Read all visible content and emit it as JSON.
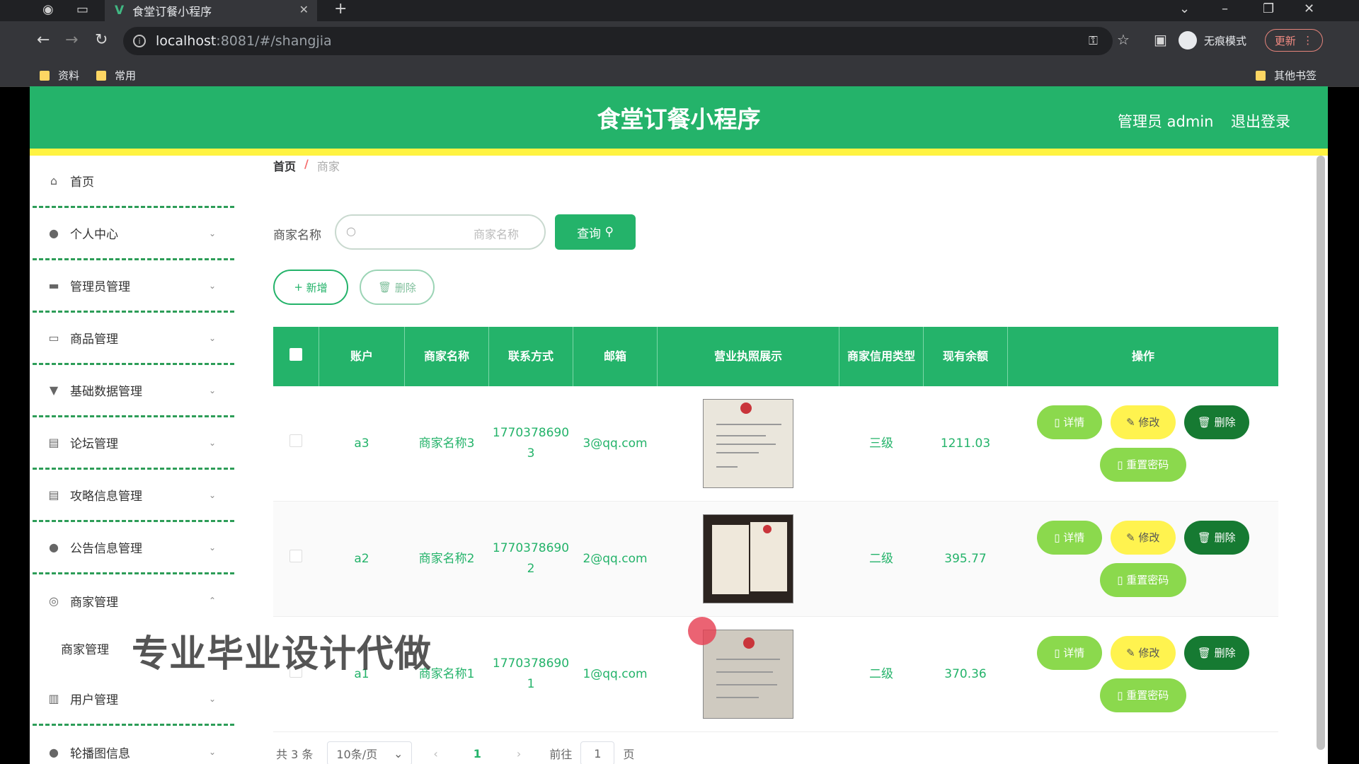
{
  "browser": {
    "tab_title": "食堂订餐小程序",
    "tab_close": "✕",
    "new_tab": "+",
    "url_host": "localhost",
    "url_path": ":8081/#/shangjia",
    "incognito_label": "无痕模式",
    "update_label": "更新",
    "bookmarks": [
      "资料",
      "常用"
    ],
    "other_bookmarks": "其他书签"
  },
  "header": {
    "title": "食堂订餐小程序",
    "admin_label": "管理员 admin",
    "logout_label": "退出登录"
  },
  "sidebar": {
    "items": [
      {
        "label": "首页",
        "icon": "home-icon"
      },
      {
        "label": "个人中心",
        "icon": "user-icon"
      },
      {
        "label": "管理员管理",
        "icon": "briefcase-icon"
      },
      {
        "label": "商品管理",
        "icon": "chat-icon"
      },
      {
        "label": "基础数据管理",
        "icon": "pin-icon"
      },
      {
        "label": "论坛管理",
        "icon": "clipboard-icon"
      },
      {
        "label": "攻略信息管理",
        "icon": "list-icon"
      },
      {
        "label": "公告信息管理",
        "icon": "location-icon"
      },
      {
        "label": "商家管理",
        "icon": "compass-icon"
      },
      {
        "label": "用户管理",
        "icon": "chart-icon"
      },
      {
        "label": "轮播图信息",
        "icon": "user-icon"
      }
    ],
    "sub_item": "商家管理"
  },
  "watermark": "专业毕业设计代做",
  "breadcrumb": {
    "home": "首页",
    "separator": "/",
    "current": "商家"
  },
  "search": {
    "label": "商家名称",
    "placeholder": "商家名称",
    "query_button": "查询"
  },
  "actions": {
    "add": "新增",
    "delete": "删除"
  },
  "table": {
    "headers": [
      "账户",
      "商家名称",
      "联系方式",
      "邮箱",
      "营业执照展示",
      "商家信用类型",
      "现有余额",
      "操作"
    ],
    "rows": [
      {
        "account": "a3",
        "name": "商家名称3",
        "phone": "17703786903",
        "email": "3@qq.com",
        "credit": "三级",
        "balance": "1211.03"
      },
      {
        "account": "a2",
        "name": "商家名称2",
        "phone": "17703786902",
        "email": "2@qq.com",
        "credit": "二级",
        "balance": "395.77"
      },
      {
        "account": "a1",
        "name": "商家名称1",
        "phone": "17703786901",
        "email": "1@qq.com",
        "credit": "二级",
        "balance": "370.36"
      }
    ],
    "op_labels": {
      "detail": "详情",
      "edit": "修改",
      "delete": "删除",
      "reset": "重置密码"
    }
  },
  "pagination": {
    "total": "共 3 条",
    "page_size": "10条/页",
    "current_page": "1",
    "goto_label": "前往",
    "goto_value": "1",
    "page_suffix": "页"
  }
}
